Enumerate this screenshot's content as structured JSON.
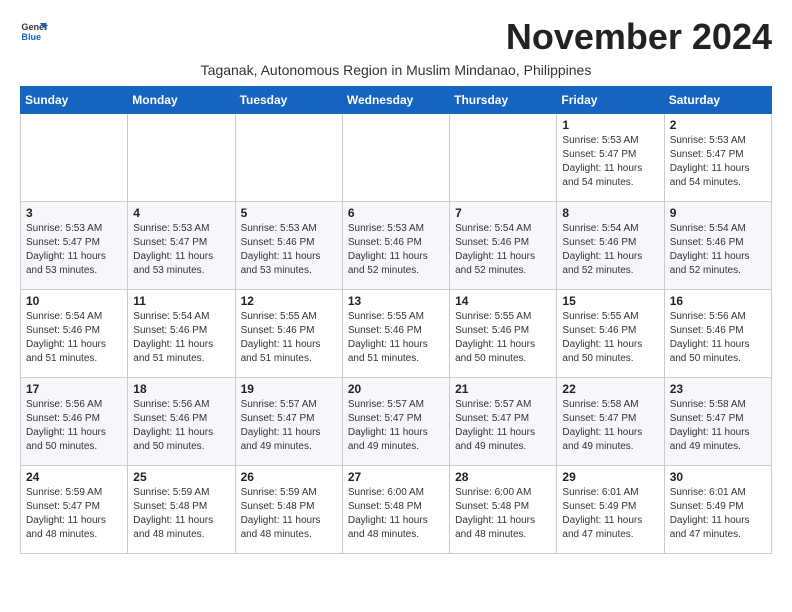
{
  "header": {
    "logo_general": "General",
    "logo_blue": "Blue",
    "month_title": "November 2024",
    "subtitle": "Taganak, Autonomous Region in Muslim Mindanao, Philippines"
  },
  "days_of_week": [
    "Sunday",
    "Monday",
    "Tuesday",
    "Wednesday",
    "Thursday",
    "Friday",
    "Saturday"
  ],
  "weeks": [
    [
      {
        "day": "",
        "info": ""
      },
      {
        "day": "",
        "info": ""
      },
      {
        "day": "",
        "info": ""
      },
      {
        "day": "",
        "info": ""
      },
      {
        "day": "",
        "info": ""
      },
      {
        "day": "1",
        "info": "Sunrise: 5:53 AM\nSunset: 5:47 PM\nDaylight: 11 hours and 54 minutes."
      },
      {
        "day": "2",
        "info": "Sunrise: 5:53 AM\nSunset: 5:47 PM\nDaylight: 11 hours and 54 minutes."
      }
    ],
    [
      {
        "day": "3",
        "info": "Sunrise: 5:53 AM\nSunset: 5:47 PM\nDaylight: 11 hours and 53 minutes."
      },
      {
        "day": "4",
        "info": "Sunrise: 5:53 AM\nSunset: 5:47 PM\nDaylight: 11 hours and 53 minutes."
      },
      {
        "day": "5",
        "info": "Sunrise: 5:53 AM\nSunset: 5:46 PM\nDaylight: 11 hours and 53 minutes."
      },
      {
        "day": "6",
        "info": "Sunrise: 5:53 AM\nSunset: 5:46 PM\nDaylight: 11 hours and 52 minutes."
      },
      {
        "day": "7",
        "info": "Sunrise: 5:54 AM\nSunset: 5:46 PM\nDaylight: 11 hours and 52 minutes."
      },
      {
        "day": "8",
        "info": "Sunrise: 5:54 AM\nSunset: 5:46 PM\nDaylight: 11 hours and 52 minutes."
      },
      {
        "day": "9",
        "info": "Sunrise: 5:54 AM\nSunset: 5:46 PM\nDaylight: 11 hours and 52 minutes."
      }
    ],
    [
      {
        "day": "10",
        "info": "Sunrise: 5:54 AM\nSunset: 5:46 PM\nDaylight: 11 hours and 51 minutes."
      },
      {
        "day": "11",
        "info": "Sunrise: 5:54 AM\nSunset: 5:46 PM\nDaylight: 11 hours and 51 minutes."
      },
      {
        "day": "12",
        "info": "Sunrise: 5:55 AM\nSunset: 5:46 PM\nDaylight: 11 hours and 51 minutes."
      },
      {
        "day": "13",
        "info": "Sunrise: 5:55 AM\nSunset: 5:46 PM\nDaylight: 11 hours and 51 minutes."
      },
      {
        "day": "14",
        "info": "Sunrise: 5:55 AM\nSunset: 5:46 PM\nDaylight: 11 hours and 50 minutes."
      },
      {
        "day": "15",
        "info": "Sunrise: 5:55 AM\nSunset: 5:46 PM\nDaylight: 11 hours and 50 minutes."
      },
      {
        "day": "16",
        "info": "Sunrise: 5:56 AM\nSunset: 5:46 PM\nDaylight: 11 hours and 50 minutes."
      }
    ],
    [
      {
        "day": "17",
        "info": "Sunrise: 5:56 AM\nSunset: 5:46 PM\nDaylight: 11 hours and 50 minutes."
      },
      {
        "day": "18",
        "info": "Sunrise: 5:56 AM\nSunset: 5:46 PM\nDaylight: 11 hours and 50 minutes."
      },
      {
        "day": "19",
        "info": "Sunrise: 5:57 AM\nSunset: 5:47 PM\nDaylight: 11 hours and 49 minutes."
      },
      {
        "day": "20",
        "info": "Sunrise: 5:57 AM\nSunset: 5:47 PM\nDaylight: 11 hours and 49 minutes."
      },
      {
        "day": "21",
        "info": "Sunrise: 5:57 AM\nSunset: 5:47 PM\nDaylight: 11 hours and 49 minutes."
      },
      {
        "day": "22",
        "info": "Sunrise: 5:58 AM\nSunset: 5:47 PM\nDaylight: 11 hours and 49 minutes."
      },
      {
        "day": "23",
        "info": "Sunrise: 5:58 AM\nSunset: 5:47 PM\nDaylight: 11 hours and 49 minutes."
      }
    ],
    [
      {
        "day": "24",
        "info": "Sunrise: 5:59 AM\nSunset: 5:47 PM\nDaylight: 11 hours and 48 minutes."
      },
      {
        "day": "25",
        "info": "Sunrise: 5:59 AM\nSunset: 5:48 PM\nDaylight: 11 hours and 48 minutes."
      },
      {
        "day": "26",
        "info": "Sunrise: 5:59 AM\nSunset: 5:48 PM\nDaylight: 11 hours and 48 minutes."
      },
      {
        "day": "27",
        "info": "Sunrise: 6:00 AM\nSunset: 5:48 PM\nDaylight: 11 hours and 48 minutes."
      },
      {
        "day": "28",
        "info": "Sunrise: 6:00 AM\nSunset: 5:48 PM\nDaylight: 11 hours and 48 minutes."
      },
      {
        "day": "29",
        "info": "Sunrise: 6:01 AM\nSunset: 5:49 PM\nDaylight: 11 hours and 47 minutes."
      },
      {
        "day": "30",
        "info": "Sunrise: 6:01 AM\nSunset: 5:49 PM\nDaylight: 11 hours and 47 minutes."
      }
    ]
  ]
}
